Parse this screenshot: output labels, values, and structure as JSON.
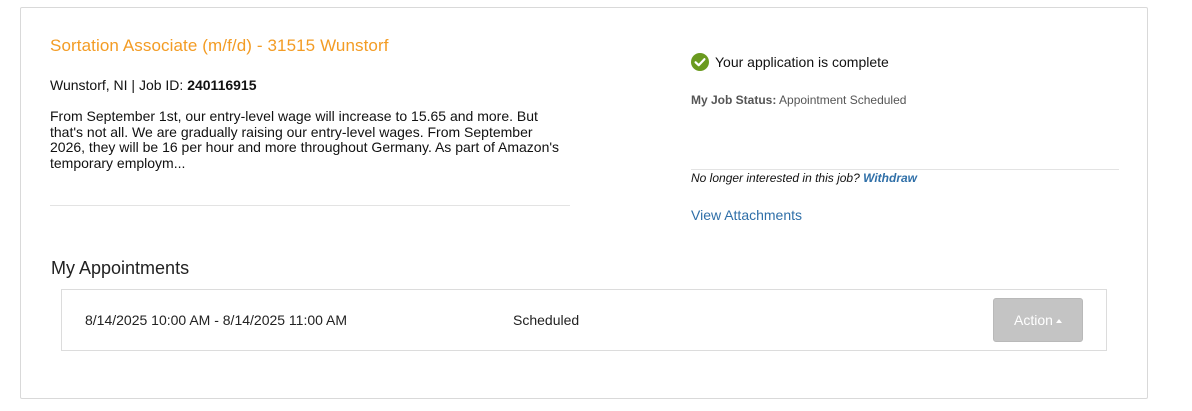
{
  "job": {
    "title": "Sortation Associate (m/f/d) - 31515 Wunstorf",
    "location_prefix": "Wunstorf, NI | Job ID: ",
    "job_id": "240116915",
    "description": "From September 1st, our entry-level wage will increase to 15.65 and more. But that's not all. We are gradually raising our entry-level wages. From September 2026, they will be 16 per hour and more throughout Germany. As part of Amazon's temporary employm..."
  },
  "application": {
    "complete_text": "Your application is complete",
    "status_label": "My Job Status:",
    "status_value": "Appointment Scheduled",
    "withdraw_prompt": "No longer interested in this job?",
    "withdraw_link": "Withdraw",
    "attachments_link": "View Attachments",
    "check_color": "#6a9a1f"
  },
  "appointments": {
    "heading": "My Appointments",
    "rows": [
      {
        "time": "8/14/2025 10:00 AM - 8/14/2025 11:00 AM",
        "status": "Scheduled",
        "action_label": "Action"
      }
    ]
  },
  "colors": {
    "title": "#f39c24",
    "link": "#2f6fa8",
    "action_button": "#c4c4c4"
  },
  "icons": {
    "status": "check-circle-icon",
    "action_caret": "caret-up-icon"
  }
}
